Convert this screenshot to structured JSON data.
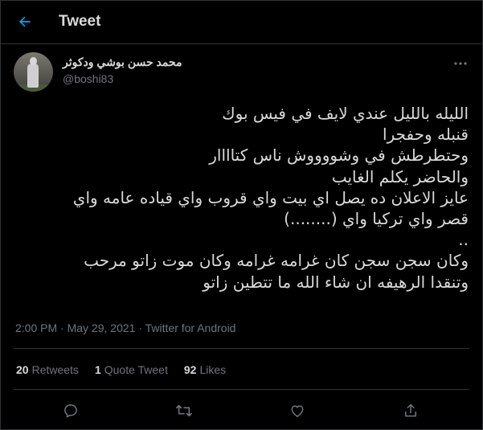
{
  "header": {
    "title": "Tweet",
    "back_icon": "arrow-left-icon"
  },
  "author": {
    "display_name": "محمد حسن بوشي ودكوثر",
    "handle": "@boshi83"
  },
  "tweet": {
    "lines": [
      "الليله بالليل عندي لايف في فيس بوك",
      "قنبله وحفجرا",
      "وحتطرطش في وشووووش ناس كتاااار",
      "والحاضر يكلم الغايب",
      "عايز الاعلان ده يصل اي بيت واي قروب واي قياده عامه واي",
      "قصر واي تركيا واي (........)",
      "..",
      "وكان سجن سجن كان غرامه غرامه وكان موت زاتو مرحب",
      "وتنقدا الرهيفه ان شاء الله ما تتطين زاتو"
    ],
    "time": "2:00 PM",
    "date": "May 29, 2021",
    "source": "Twitter for Android"
  },
  "stats": {
    "retweets_count": "20",
    "retweets_label": "Retweets",
    "quotes_count": "1",
    "quotes_label": "Quote Tweet",
    "likes_count": "92",
    "likes_label": "Likes"
  },
  "colors": {
    "background": "#000000",
    "text": "#d9d9d9",
    "secondary": "#6e767d",
    "accent": "#1d9bf0",
    "border": "#2f3336"
  },
  "actions": [
    "reply-icon",
    "retweet-icon",
    "like-icon",
    "share-icon"
  ]
}
